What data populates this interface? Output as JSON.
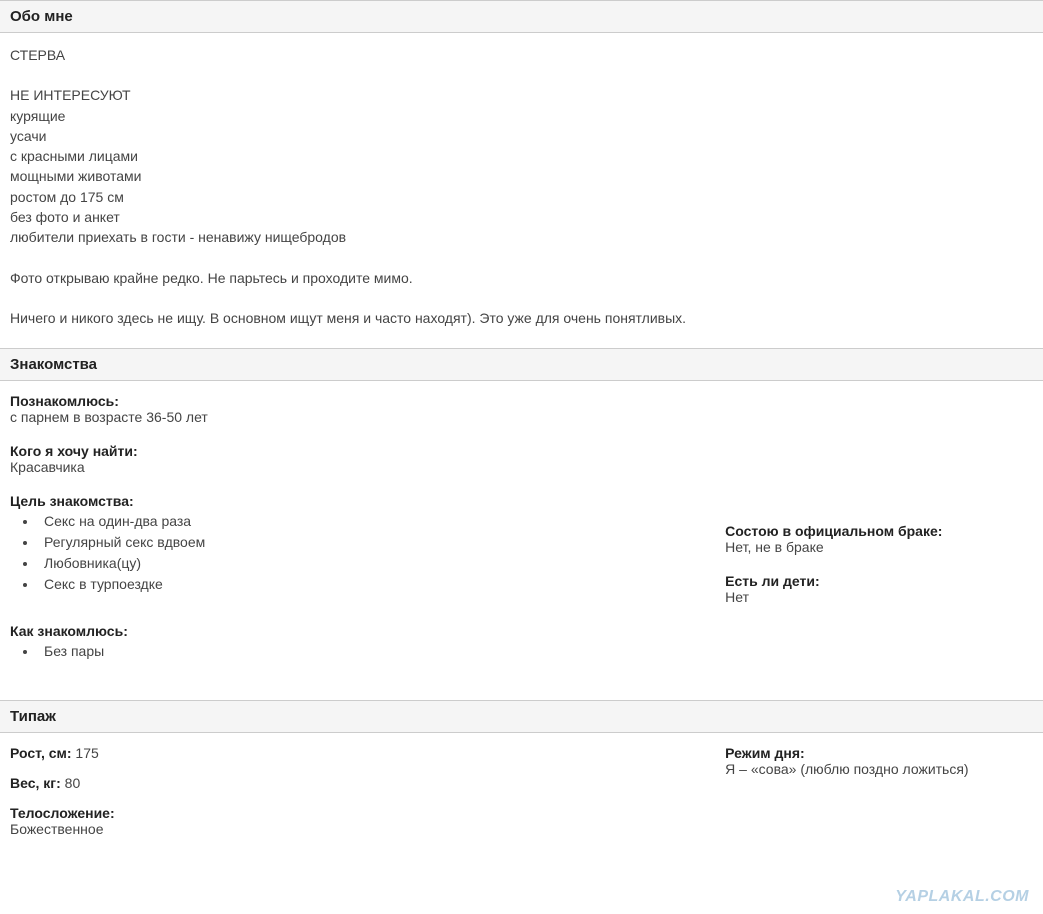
{
  "about": {
    "header": "Обо мне",
    "lines": [
      "СТЕРВА",
      "",
      "НЕ ИНТЕРЕСУЮТ",
      "курящие",
      "усачи",
      "с красными лицами",
      "мощными животами",
      "ростом до 175 см",
      "без фото и анкет",
      "любители приехать в гости - ненавижу нищебродов",
      "",
      "Фото открываю крайне редко. Не парьтесь и проходите мимо.",
      "",
      "Ничего и никого здесь не ищу. В основном ищут меня и часто находят). Это уже для очень понятливых."
    ]
  },
  "dating": {
    "header": "Знакомства",
    "meet_label": "Познакомлюсь:",
    "meet_value": "с парнем в возрасте 36-50 лет",
    "want_label": "Кого я хочу найти:",
    "want_value": "Красавчика",
    "purpose_label": "Цель знакомства:",
    "purpose_items": [
      "Секс на один-два раза",
      "Регулярный секс вдвоем",
      "Любовника(цу)",
      "Секс в турпоездке"
    ],
    "how_label": "Как знакомлюсь:",
    "how_items": [
      "Без пары"
    ],
    "marriage_label": "Состою в официальном браке:",
    "marriage_value": "Нет, не в браке",
    "children_label": "Есть ли дети:",
    "children_value": "Нет"
  },
  "type": {
    "header": "Типаж",
    "height_label": "Рост, см:",
    "height_value": "175",
    "weight_label": "Вес, кг:",
    "weight_value": "80",
    "body_label": "Телосложение:",
    "body_value": "Божественное",
    "regime_label": "Режим дня:",
    "regime_value": "Я – «сова» (люблю поздно ложиться)"
  },
  "watermark": "YAPLAKAL.COM"
}
